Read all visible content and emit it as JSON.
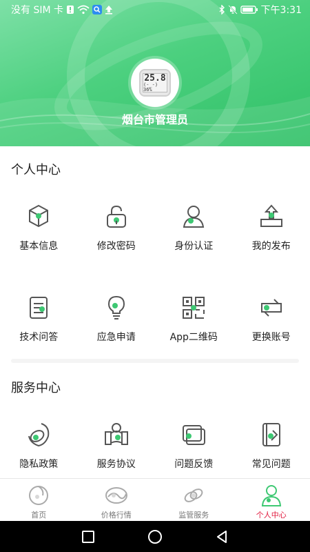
{
  "status_bar": {
    "carrier": "没有 SIM 卡",
    "time": "下午3:31",
    "icons": [
      "sim-alert-icon",
      "wifi-icon",
      "search-badge-icon",
      "upload-icon",
      "bluetooth-icon",
      "mute-icon",
      "battery-icon"
    ]
  },
  "profile": {
    "avatar_lcd_temp": "25.8",
    "avatar_lcd_hum": "(-_-) 36%",
    "name": "烟台市管理员"
  },
  "personal_center": {
    "title": "个人中心",
    "items": [
      {
        "label": "基本信息",
        "icon": "cube-info-icon"
      },
      {
        "label": "修改密码",
        "icon": "lock-icon"
      },
      {
        "label": "身份认证",
        "icon": "user-verify-icon"
      },
      {
        "label": "我的发布",
        "icon": "publish-icon"
      },
      {
        "label": "技术问答",
        "icon": "qa-doc-icon"
      },
      {
        "label": "应急申请",
        "icon": "bulb-icon"
      },
      {
        "label": "App二维码",
        "icon": "qrcode-icon"
      },
      {
        "label": "更换账号",
        "icon": "switch-account-icon"
      }
    ]
  },
  "service_center": {
    "title": "服务中心",
    "items": [
      {
        "label": "隐私政策",
        "icon": "privacy-icon"
      },
      {
        "label": "服务协议",
        "icon": "agreement-icon"
      },
      {
        "label": "问题反馈",
        "icon": "feedback-icon"
      },
      {
        "label": "常见问题",
        "icon": "faq-icon"
      }
    ]
  },
  "tabbar": {
    "tabs": [
      {
        "label": "首页",
        "icon": "home-icon",
        "active": false
      },
      {
        "label": "价格行情",
        "icon": "price-icon",
        "active": false
      },
      {
        "label": "监管服务",
        "icon": "supervision-icon",
        "active": false
      },
      {
        "label": "个人中心",
        "icon": "profile-icon",
        "active": true
      }
    ]
  },
  "colors": {
    "brand_green": "#3ec873",
    "active_tab": "#e1173c",
    "icon_stroke": "#555555",
    "icon_accent": "#3ec873"
  }
}
